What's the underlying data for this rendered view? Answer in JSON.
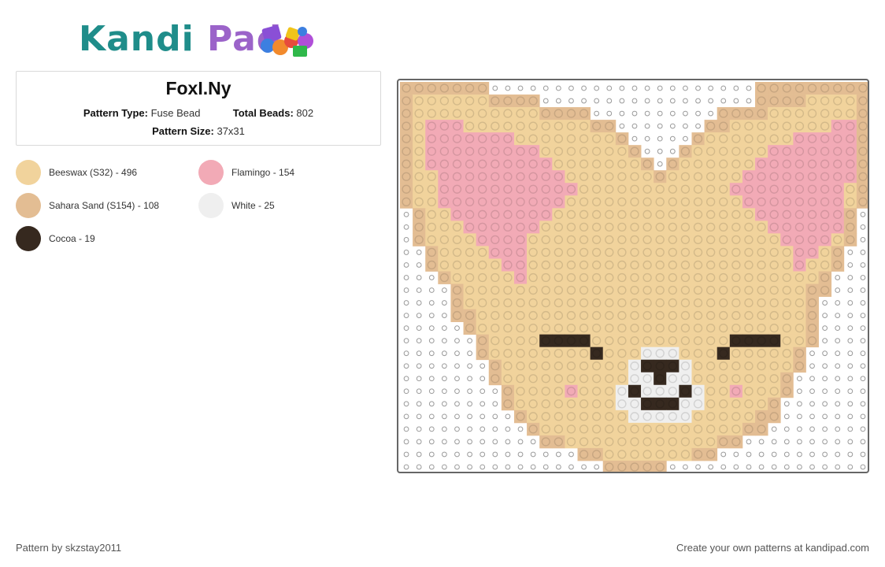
{
  "header": {
    "logo_text_part1": "Kandi",
    "logo_text_part2": "Pad"
  },
  "pattern": {
    "title": "FoxI.Ny",
    "type_label": "Pattern Type:",
    "type_value": "Fuse Bead",
    "beads_label": "Total Beads:",
    "beads_value": "802",
    "size_label": "Pattern Size:",
    "size_value": "37x31"
  },
  "legend": [
    {
      "label": "Beeswax (S32) - 496",
      "color": "#f1d39c"
    },
    {
      "label": "Flamingo - 154",
      "color": "#f2aab6"
    },
    {
      "label": "Sahara Sand (S154) - 108",
      "color": "#e3bd93"
    },
    {
      "label": "White - 25",
      "color": "#efefef"
    },
    {
      "label": "Cocoa - 19",
      "color": "#36291f"
    }
  ],
  "grid": {
    "cols": 37,
    "rows": 31,
    "palette": {
      "B": "#f1d39c",
      "S": "#e3bd93",
      "P": "#f2aab6",
      "W": "#efefef",
      "C": "#36291f",
      ".": "#ffffff"
    },
    "cells": [
      "SSSSSSS.....................SSSSSSSSS",
      "SBBBBBBSSSS.................SSSSBBBBS",
      "SBBBBBBBBBBSSSS..........SSSSBBBBBBBS",
      "SBPPPBBBBBBBBBBSS.......SSBBBBBBBBPPS",
      "SBPPPPPPPBBBBBBBBS.....SBBBBBBBPPPPPS",
      "SBPPPPPPPPPBBBBBBBS...SBBBBBBPPPPPPPS",
      "SBPPPPPPPPPPBBBBBBBS.SBBBBBBPPPPPPPPS",
      "SBBPPPPPPPPPPBBBBBBBSBBBBBBPPPPPPPPPS",
      "SBBPPPPPPPPPPPBBBBBBBBBBBBPPPPPPPPPBS",
      "SBBPPPPPPPPPPBBBBBBBBBBBBBBPPPPPPPPBS",
      ".SBBPPPPPPPPBBBBBBBBBBBBBBBBPPPPPPPS.",
      ".SBBBPPPPPPBBBBBBBBBBBBBBBBBBPPPPPPS.",
      ".SBBBBPPPPBBBBBBBBBBBBBBBBBBBBPPPPBS.",
      "..SBBBBPPPBBBBBBBBBBBBBBBBBBBBBPPBS..",
      "..SBBBBBPPBBBBBBBBBBBBBBBBBBBBBPBBS..",
      "...SBBBBBPBBBBBBBBBBBBBBBBBBBBBBBS...",
      "....SBBBBBBBBBBBBBBBBBBBBBBBBBBBSS...",
      "....SBBBBBBBBBBBBBBBBBBBBBBBBBBBS....",
      "....SSBBBBBBBBBBBBBBBBBBBBBBBBBBS....",
      ".....SBBBBBBBBBBBBBBBBBBBBBBBBBBS....",
      "......SBBBBCCCCBBBBBBBBBBBCCCCBBS....",
      "......SBBBBBBBBCBBBWWWBBBCBBBBBS.....",
      ".......SBBBBBBBBBBWCCCWBBBBBBBBS.....",
      ".......SBBBBBBBBBBWWCWWBBBBBBBS......",
      "........SBBBBPBBBWCWWWCWBBPBBBS......",
      "........SBBBBBBBBWWCCCWWBBBBBS.......",
      ".........SBBBBBBBBWWWWWBBBBBSS.......",
      "..........SBBBBBBBBBBBBBBBBSS........",
      "...........SSBBBBBBBBBBBBSS..........",
      "..............SSBBBBBBBSS............",
      "................SSSSS................"
    ]
  },
  "footer": {
    "left": "Pattern by skzstay2011",
    "right": "Create your own patterns at kandipad.com"
  }
}
